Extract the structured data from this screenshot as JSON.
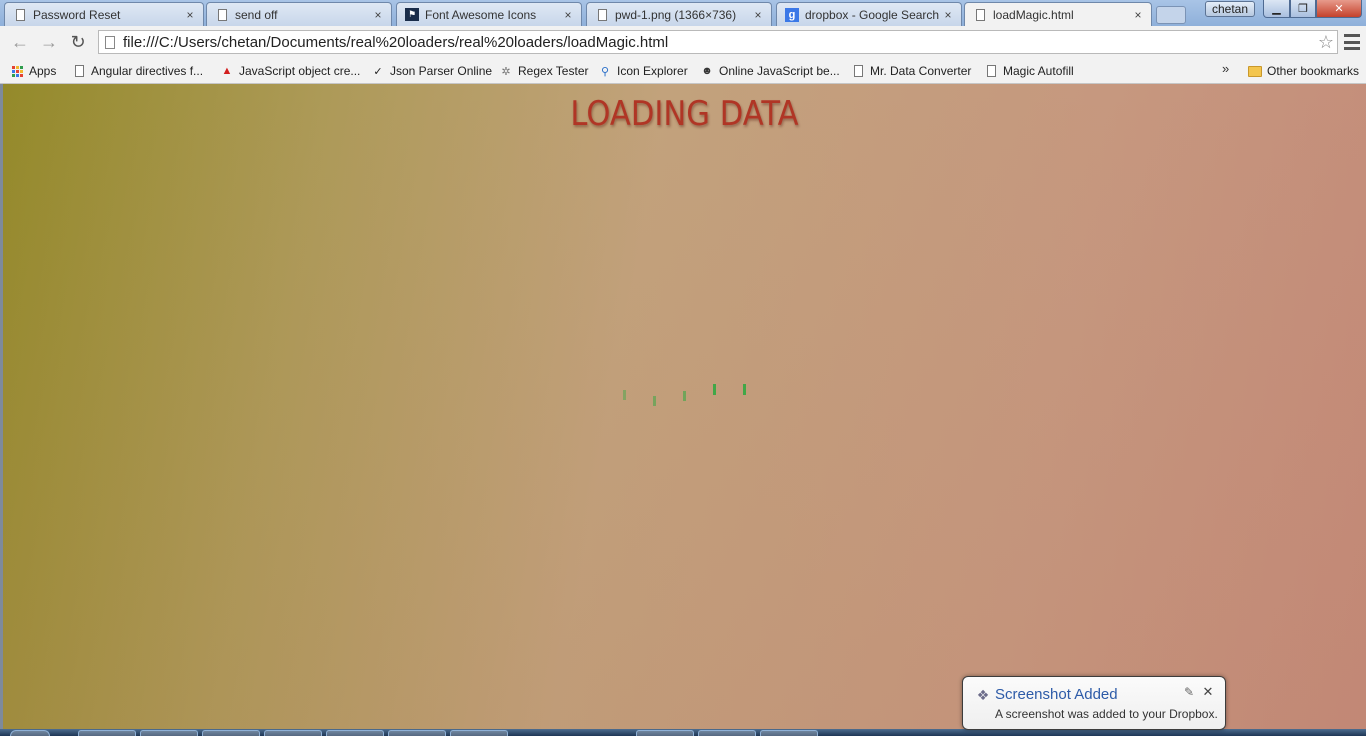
{
  "window": {
    "user_name": "chetan",
    "minimize_glyph": "▁",
    "maximize_glyph": "❐",
    "close_glyph": "✕"
  },
  "tabs": [
    {
      "title": "Password Reset",
      "icon": "document-icon",
      "close": "×"
    },
    {
      "title": "send off",
      "icon": "document-icon",
      "close": "×"
    },
    {
      "title": "Font Awesome Icons",
      "icon": "font-awesome-flag-icon",
      "close": "×"
    },
    {
      "title": "pwd-1.png (1366×736)",
      "icon": "document-icon",
      "close": "×"
    },
    {
      "title": "dropbox - Google Search",
      "icon": "google-icon",
      "close": "×"
    },
    {
      "title": "loadMagic.html",
      "icon": "document-icon",
      "close": "×",
      "active": true
    }
  ],
  "toolbar": {
    "back_glyph": "←",
    "forward_glyph": "→",
    "reload_glyph": "↻",
    "url": "file:///C:/Users/chetan/Documents/real%20loaders/real%20loaders/loadMagic.html",
    "star_glyph": "☆"
  },
  "bookmarks": {
    "items": [
      {
        "label": "Apps",
        "icon": "apps-grid-icon"
      },
      {
        "label": "Angular directives f...",
        "icon": "document-icon"
      },
      {
        "label": "JavaScript object cre...",
        "icon": "adobe-icon"
      },
      {
        "label": "Json Parser Online",
        "icon": "json-icon"
      },
      {
        "label": "Regex Tester",
        "icon": "gear-icon"
      },
      {
        "label": "Icon Explorer",
        "icon": "magnifier-icon"
      },
      {
        "label": "Online JavaScript be...",
        "icon": "cat-icon"
      },
      {
        "label": "Mr. Data Converter",
        "icon": "document-icon"
      },
      {
        "label": "Magic Autofill",
        "icon": "document-icon"
      }
    ],
    "overflow": "»",
    "other": "Other bookmarks"
  },
  "page": {
    "heading": "LOADING DATA",
    "colors": {
      "heading": "#b03525",
      "loader_bar": "#3aa845",
      "background_start": "#948a2a",
      "background_end": "#c48b79"
    }
  },
  "toast": {
    "title": "Screenshot Added",
    "body": "A screenshot was added to your Dropbox.",
    "settings_glyph": "✎",
    "close_glyph": "✕",
    "icon_glyph": "❖"
  }
}
